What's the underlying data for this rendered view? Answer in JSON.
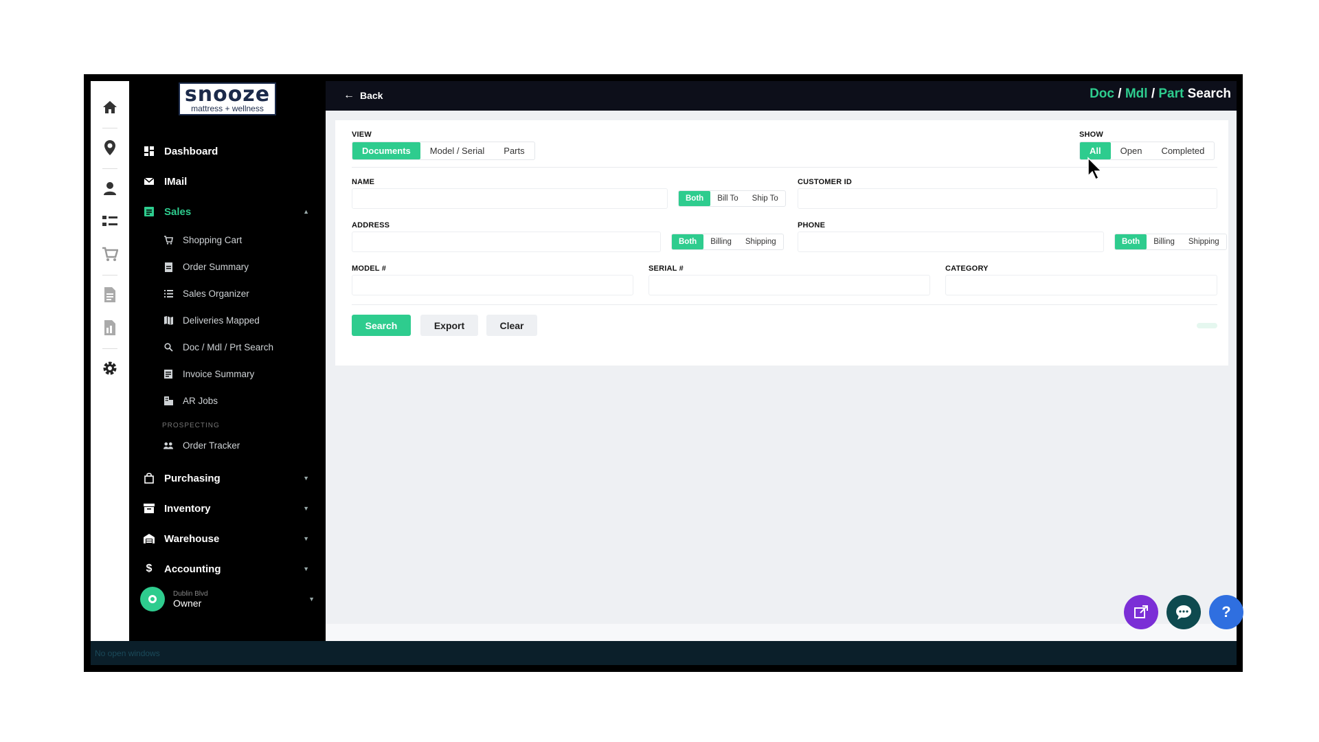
{
  "logo": {
    "main": "snooze",
    "sub": "mattress + wellness"
  },
  "rail": {
    "icons": [
      "home-icon",
      "location-pin-icon",
      "user-icon",
      "list-icon",
      "cart-icon",
      "document-icon",
      "report-icon",
      "gear-icon"
    ]
  },
  "nav": {
    "dashboard": "Dashboard",
    "imail": "IMail",
    "sales": "Sales",
    "sales_items": [
      "Shopping Cart",
      "Order Summary",
      "Sales Organizer",
      "Deliveries Mapped",
      "Doc / Mdl / Prt Search",
      "Invoice Summary",
      "AR Jobs"
    ],
    "prospecting_label": "PROSPECTING",
    "order_tracker": "Order Tracker",
    "purchasing": "Purchasing",
    "inventory": "Inventory",
    "warehouse": "Warehouse",
    "accounting": "Accounting"
  },
  "user": {
    "name": "Dublin Blvd",
    "role": "Owner"
  },
  "topbar": {
    "back": "Back",
    "title_doc": "Doc",
    "title_sep1": "/",
    "title_mdl": "Mdl",
    "title_sep2": "/",
    "title_part": "Part",
    "title_search": "Search"
  },
  "form": {
    "view_label": "VIEW",
    "view_options": [
      "Documents",
      "Model / Serial",
      "Parts"
    ],
    "show_label": "SHOW",
    "show_options": [
      "All",
      "Open",
      "Completed"
    ],
    "name_label": "NAME",
    "name_value": "",
    "name_options": [
      "Both",
      "Bill To",
      "Ship To"
    ],
    "customer_id_label": "CUSTOMER ID",
    "customer_id_value": "",
    "address_label": "ADDRESS",
    "address_value": "",
    "address_options": [
      "Both",
      "Billing",
      "Shipping"
    ],
    "phone_label": "PHONE",
    "phone_value": "",
    "phone_options": [
      "Both",
      "Billing",
      "Shipping"
    ],
    "model_label": "MODEL #",
    "model_value": "",
    "serial_label": "SERIAL #",
    "serial_value": "",
    "category_label": "CATEGORY",
    "category_value": ""
  },
  "actions": {
    "search": "Search",
    "export": "Export",
    "clear": "Clear"
  },
  "taskbar": {
    "text": "No open windows"
  },
  "colors": {
    "accent": "#2ecc8e",
    "topbar": "#0d0f1a",
    "fab_purple": "#7b2fd6",
    "fab_dark": "#0e4a4f",
    "fab_blue": "#2f6fe0"
  }
}
